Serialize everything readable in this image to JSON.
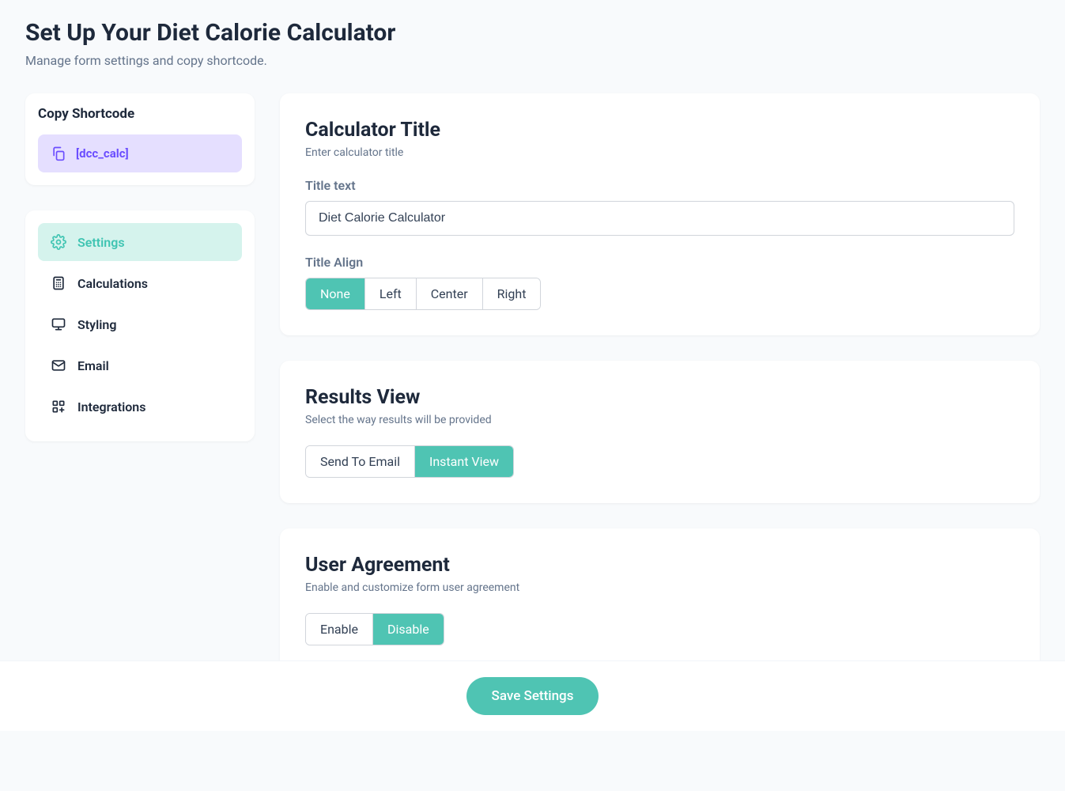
{
  "header": {
    "title": "Set Up Your Diet Calorie Calculator",
    "subtitle": "Manage form settings and copy shortcode."
  },
  "shortcode": {
    "title": "Copy Shortcode",
    "code": "[dcc_calc]"
  },
  "nav": {
    "items": [
      {
        "label": "Settings",
        "active": true
      },
      {
        "label": "Calculations",
        "active": false
      },
      {
        "label": "Styling",
        "active": false
      },
      {
        "label": "Email",
        "active": false
      },
      {
        "label": "Integrations",
        "active": false
      }
    ]
  },
  "sections": {
    "calculatorTitle": {
      "title": "Calculator Title",
      "subtitle": "Enter calculator title",
      "fieldLabel": "Title text",
      "fieldValue": "Diet Calorie Calculator",
      "alignLabel": "Title Align",
      "alignOptions": [
        "None",
        "Left",
        "Center",
        "Right"
      ],
      "alignSelected": "None"
    },
    "resultsView": {
      "title": "Results View",
      "subtitle": "Select the way results will be provided",
      "options": [
        "Send To Email",
        "Instant View"
      ],
      "selected": "Instant View"
    },
    "userAgreement": {
      "title": "User Agreement",
      "subtitle": "Enable and customize form user agreement",
      "options": [
        "Enable",
        "Disable"
      ],
      "selected": "Disable"
    }
  },
  "footer": {
    "saveLabel": "Save Settings"
  }
}
